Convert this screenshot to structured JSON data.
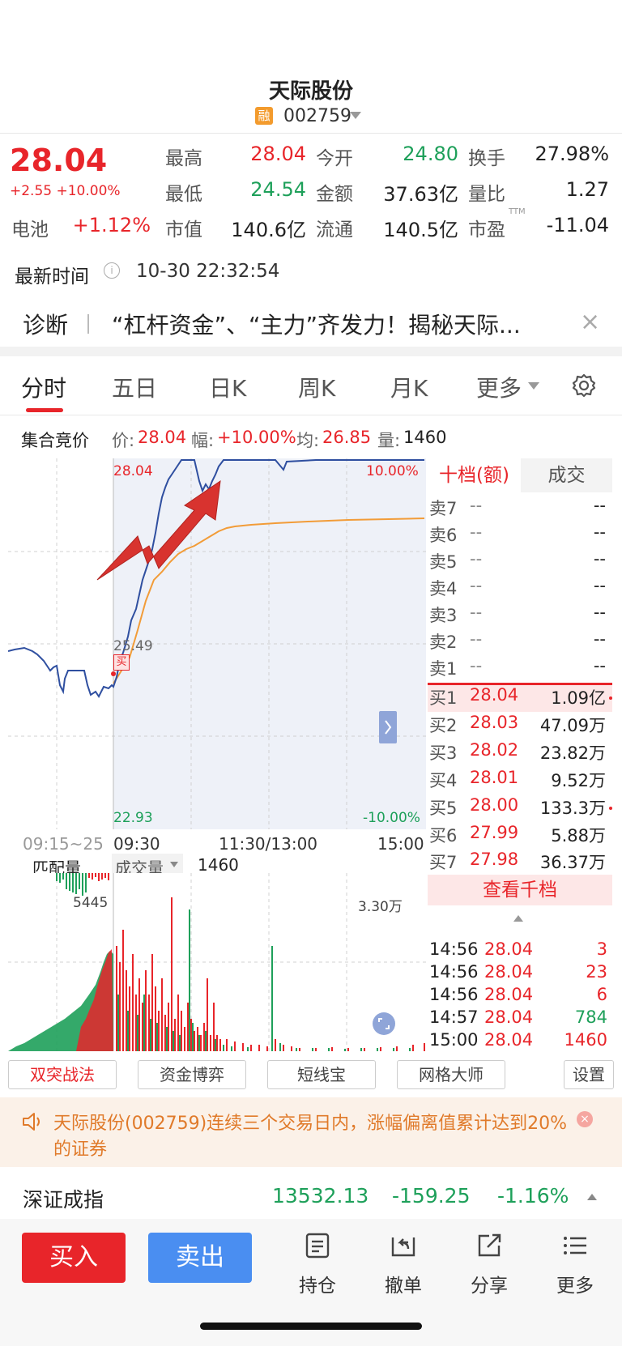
{
  "header": {
    "title": "天际股份",
    "rong_badge": "融",
    "code": "002759"
  },
  "quote": {
    "price": "28.04",
    "change": "+2.55 +10.00%",
    "stats": [
      {
        "label": "最高",
        "value": "28.04",
        "color": "red"
      },
      {
        "label": "今开",
        "value": "24.80",
        "color": "green"
      },
      {
        "label": "换手",
        "value": "27.98%",
        "color": "dark"
      },
      {
        "label": "最低",
        "value": "24.54",
        "color": "green"
      },
      {
        "label": "金额",
        "value": "37.63亿",
        "color": "dark"
      },
      {
        "label": "量比",
        "value": "1.27",
        "color": "dark"
      },
      {
        "label": "市值",
        "value": "140.6亿",
        "color": "dark"
      },
      {
        "label": "流通",
        "value": "140.5亿",
        "color": "dark"
      },
      {
        "label": "市盈",
        "value": "-11.04",
        "color": "dark"
      }
    ],
    "battery_label": "电池",
    "battery_value": "+1.12%",
    "pe_sup": "TTM"
  },
  "latest_time": {
    "label": "最新时间",
    "value": "10-30 22:32:54"
  },
  "diagnosis": {
    "label": "诊断",
    "headline": "“杠杆资金”、“主力”齐发力！揭秘天际..."
  },
  "tabs": [
    "分时",
    "五日",
    "日K",
    "周K",
    "月K",
    "更多"
  ],
  "auction": {
    "label": "集合竞价",
    "price_label": "价:",
    "price": "28.04",
    "pct_label": "幅:",
    "pct": "+10.00%",
    "avg_label": "均:",
    "avg": "26.85",
    "vol_label": "量:",
    "vol": "1460"
  },
  "chart_labels": {
    "top_price": "28.04",
    "top_pct": "10.00%",
    "bottom_price": "22.93",
    "bottom_pct": "-10.00%",
    "mid_price": "25.49",
    "buy_marker": "买",
    "x_auction": "09:15~25",
    "x_open": "09:30",
    "x_mid": "11:30/13:00",
    "x_close": "15:00"
  },
  "volume": {
    "match_label": "匹配量",
    "vol_dropdown": "成交量",
    "vol_value": "1460",
    "left_max": "5445",
    "right_max": "3.30万"
  },
  "orderbook": {
    "tab_active": "十档(额)",
    "tab_other": "成交",
    "sells": [
      {
        "name": "卖7",
        "price": "--",
        "vol": "--"
      },
      {
        "name": "卖6",
        "price": "--",
        "vol": "--"
      },
      {
        "name": "卖5",
        "price": "--",
        "vol": "--"
      },
      {
        "name": "卖4",
        "price": "--",
        "vol": "--"
      },
      {
        "name": "卖3",
        "price": "--",
        "vol": "--"
      },
      {
        "name": "卖2",
        "price": "--",
        "vol": "--"
      },
      {
        "name": "卖1",
        "price": "--",
        "vol": "--"
      }
    ],
    "buys": [
      {
        "name": "买1",
        "price": "28.04",
        "vol": "1.09亿"
      },
      {
        "name": "买2",
        "price": "28.03",
        "vol": "47.09万"
      },
      {
        "name": "买3",
        "price": "28.02",
        "vol": "23.82万"
      },
      {
        "name": "买4",
        "price": "28.01",
        "vol": "9.52万"
      },
      {
        "name": "买5",
        "price": "28.00",
        "vol": "133.3万"
      },
      {
        "name": "买6",
        "price": "27.99",
        "vol": "5.88万"
      },
      {
        "name": "买7",
        "price": "27.98",
        "vol": "36.37万"
      }
    ],
    "view_all": "查看千档"
  },
  "ticks": [
    {
      "time": "14:56",
      "price": "28.04",
      "vol": "3",
      "color": "red"
    },
    {
      "time": "14:56",
      "price": "28.04",
      "vol": "23",
      "color": "red"
    },
    {
      "time": "14:56",
      "price": "28.04",
      "vol": "6",
      "color": "red"
    },
    {
      "time": "14:57",
      "price": "28.04",
      "vol": "784",
      "color": "green"
    },
    {
      "time": "15:00",
      "price": "28.04",
      "vol": "1460",
      "color": "red"
    }
  ],
  "tools": [
    "双突战法",
    "资金博弈",
    "短线宝",
    "网格大师",
    "设置"
  ],
  "notice": {
    "text": "天际股份(002759)连续三个交易日内，涨幅偏离值累计达到20%的证券"
  },
  "index_bar": {
    "name": "深证成指",
    "value": "13532.13",
    "change": "-159.25",
    "pct": "-1.16%"
  },
  "bottom_nav": {
    "buy": "买入",
    "sell": "卖出",
    "items": [
      {
        "label": "持仓",
        "icon": "holdings-icon"
      },
      {
        "label": "撤单",
        "icon": "cancel-order-icon"
      },
      {
        "label": "分享",
        "icon": "share-icon"
      },
      {
        "label": "更多",
        "icon": "more-list-icon"
      }
    ]
  }
}
